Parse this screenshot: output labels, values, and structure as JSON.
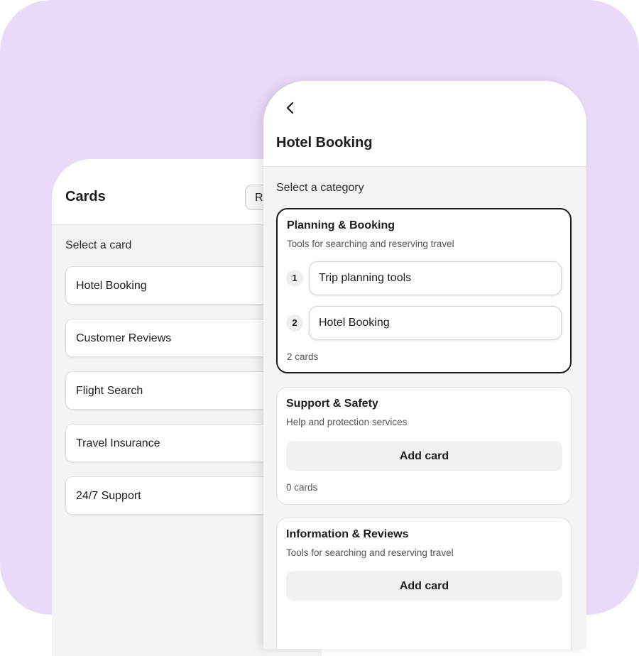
{
  "cards_screen": {
    "title": "Cards",
    "header_button_label": "R",
    "subtitle": "Select a card",
    "items": [
      {
        "label": "Hotel Booking"
      },
      {
        "label": "Customer Reviews"
      },
      {
        "label": "Flight Search"
      },
      {
        "label": "Travel Insurance"
      },
      {
        "label": "24/7 Support"
      }
    ]
  },
  "detail_screen": {
    "back_icon": "chevron-left-icon",
    "title": "Hotel Booking",
    "subtitle": "Select a category",
    "categories": [
      {
        "title": "Planning & Booking",
        "description": "Tools for searching and reserving travel",
        "selected": true,
        "cards": [
          {
            "index": "1",
            "label": "Trip planning tools"
          },
          {
            "index": "2",
            "label": "Hotel Booking"
          }
        ],
        "count_label": "2 cards"
      },
      {
        "title": "Support & Safety",
        "description": "Help and protection services",
        "selected": false,
        "add_button_label": "Add card",
        "count_label": "0 cards"
      },
      {
        "title": "Information & Reviews",
        "description": "Tools for searching and reserving travel",
        "selected": false,
        "add_button_label": "Add card"
      }
    ]
  },
  "colors": {
    "backdrop": "#e9daf9",
    "surface": "#ffffff",
    "screen_bg": "#f4f4f4",
    "selected_border": "#1c1c1c"
  }
}
